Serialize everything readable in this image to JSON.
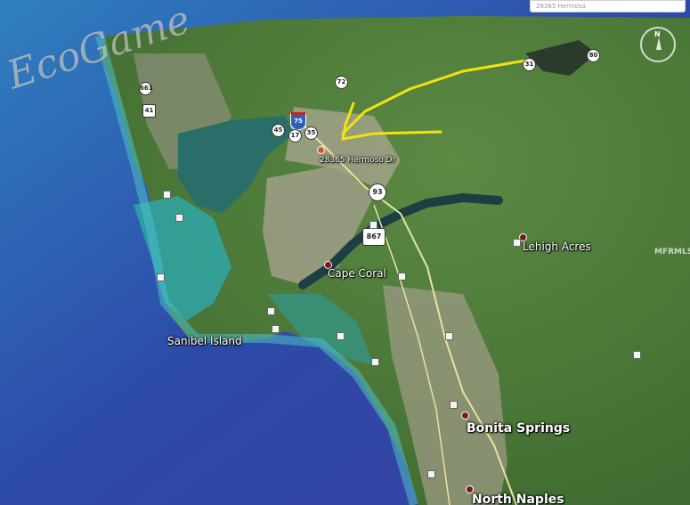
{
  "search": {
    "placeholder": "28365 Hermosa"
  },
  "compass": {
    "label": "N"
  },
  "watermark": {
    "text": "EcoGame"
  },
  "logo": {
    "text": "MFRMLS"
  },
  "labels": {
    "address": "28365 Hermoso Dr",
    "lehigh": "Lehigh Acres",
    "cape_coral": "Cape Coral",
    "sanibel": "Sanibel Island",
    "bonita": "Bonita Springs",
    "north_naples": "North Naples"
  },
  "roads": {
    "i75": "75",
    "r45": "45",
    "r17": "17",
    "r35": "35",
    "r72": "72",
    "r93": "93",
    "r867": "867",
    "r661": "661",
    "r41": "41",
    "r31": "31",
    "r80": "80"
  },
  "colors": {
    "water_deep": "#2a3f9e",
    "water_shallow": "#2fa6a6",
    "land": "#4f7a3a",
    "urban": "#9a9b86",
    "route": "#f2e20f"
  }
}
